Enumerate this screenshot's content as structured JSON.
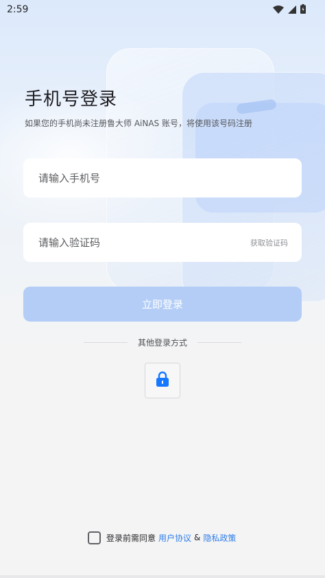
{
  "status_bar": {
    "time": "2:59",
    "icons": [
      "wifi-icon",
      "signal-icon",
      "battery-icon"
    ]
  },
  "login": {
    "title": "手机号登录",
    "subtitle": "如果您的手机尚未注册鲁大师 AiNAS 账号，将使用该号码注册",
    "phone_placeholder": "请输入手机号",
    "code_placeholder": "请输入验证码",
    "get_code_label": "获取验证码",
    "submit_label": "立即登录",
    "other_methods_label": "其他登录方式",
    "alt_method_icon": "lock-icon"
  },
  "agreement": {
    "prefix": "登录前需同意",
    "user_agreement": "用户协议",
    "amp": "&",
    "privacy_policy": "隐私政策"
  },
  "colors": {
    "accent": "#2f7ee8",
    "button_disabled": "#b3cdf6",
    "background": "#f4f4f5"
  }
}
